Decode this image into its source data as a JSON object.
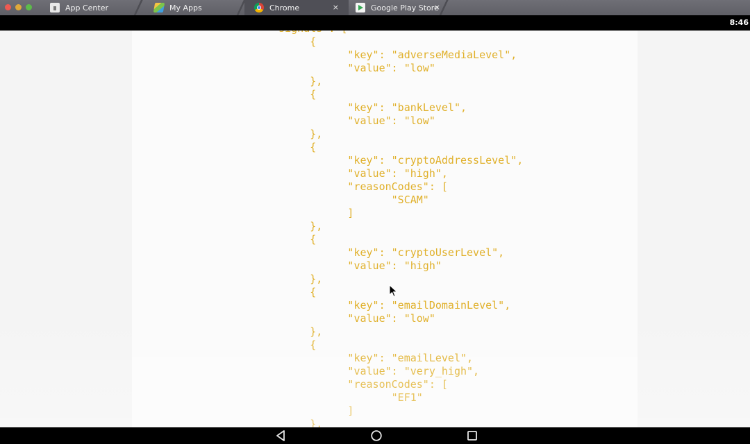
{
  "window": {
    "tabs": [
      {
        "label": "App Center",
        "icon": "app-center-icon",
        "active": false
      },
      {
        "label": "My Apps",
        "icon": "my-apps-icon",
        "active": false
      },
      {
        "label": "Chrome",
        "icon": "chrome-icon",
        "active": true,
        "close": "×"
      },
      {
        "label": "Google Play Store",
        "icon": "play-store-icon",
        "active": false,
        "close": "×"
      }
    ]
  },
  "status_bar": {
    "time": "8:46"
  },
  "code": {
    "text_color": "#e0b02a",
    "lines": [
      "  \"signals\": [",
      "        {",
      "              \"key\": \"adverseMediaLevel\",",
      "              \"value\": \"low\"",
      "        },",
      "        {",
      "              \"key\": \"bankLevel\",",
      "              \"value\": \"low\"",
      "        },",
      "        {",
      "              \"key\": \"cryptoAddressLevel\",",
      "              \"value\": \"high\",",
      "              \"reasonCodes\": [",
      "                     \"SCAM\"",
      "              ]",
      "        },",
      "        {",
      "              \"key\": \"cryptoUserLevel\",",
      "              \"value\": \"high\"",
      "        },",
      "        {",
      "              \"key\": \"emailDomainLevel\",",
      "              \"value\": \"low\"",
      "        },",
      "        {",
      "              \"key\": \"emailLevel\",",
      "              \"value\": \"very_high\",",
      "              \"reasonCodes\": [",
      "                     \"EF1\"",
      "              ]",
      "        },"
    ]
  },
  "nav_bar": {
    "buttons": [
      "back-icon",
      "home-icon",
      "recent-apps-icon"
    ]
  }
}
